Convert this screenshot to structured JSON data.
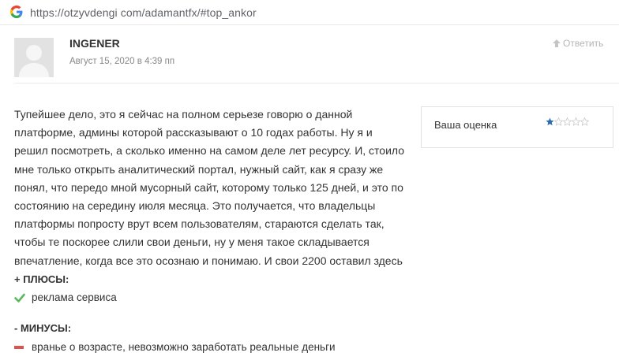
{
  "browser": {
    "url": "https://otzyvdengi com/adamantfx/#top_ankor"
  },
  "comment": {
    "author": "INGENER",
    "date": "Август 15, 2020 в 4:39 пп",
    "reply_label": "Ответить",
    "body_lines": [
      "Тупейшее дело, это я сейчас на полном серьезе говорю о данной",
      "платформе, админы которой рассказывают о 10 годах работы. Ну я и",
      "решил посмотреть, а сколько именно на самом деле лет ресурсу. И, стоило",
      "мне только открыть аналитический портал, нужный сайт, как я сразу же",
      "понял, что передо мной мусорный сайт, которому только 125 дней, и это по",
      "состоянию на середину июля месяца. Это получается, что владельцы",
      "платформы попросту врут всем пользователям, стараются сделать так,",
      "чтобы те поскорее слили свои деньги, ну у меня такое складывается",
      "впечатление, когда все это осознаю и понимаю. И свои 2200 оставил здесь"
    ],
    "rating": {
      "label": "Ваша оценка",
      "value": 1,
      "max": 5,
      "filled_color": "#2b6cb0",
      "empty_color": "#c8c8c8"
    },
    "pros": {
      "heading": "+ ПЛЮСЫ:",
      "items": [
        "реклама сервиса"
      ],
      "icon": "check-icon",
      "color": "#5cb85c"
    },
    "cons": {
      "heading": "- МИНУСЫ:",
      "items": [
        "вранье о возрасте, невозможно заработать реальные деньги"
      ],
      "icon": "minus-icon",
      "color": "#d9534f"
    }
  }
}
